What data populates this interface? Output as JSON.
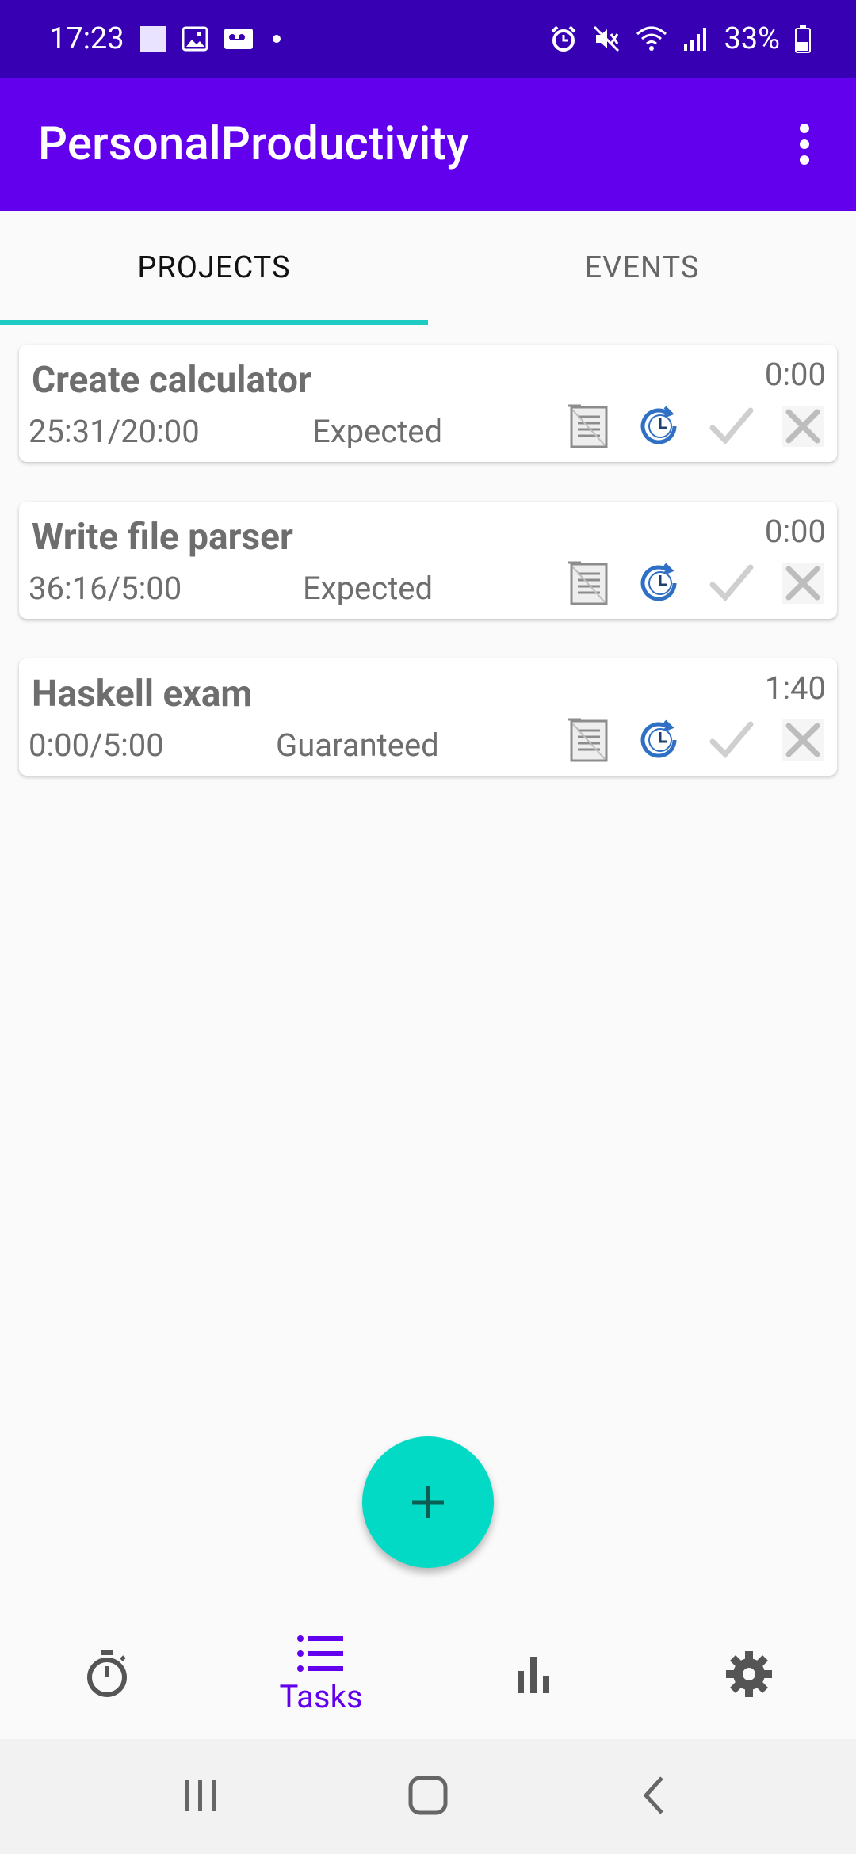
{
  "status_bar": {
    "time": "17:23",
    "battery": "33%",
    "icons_left": [
      "square-notification-icon",
      "gallery-icon",
      "voicemail-icon",
      "dot-icon"
    ],
    "icons_right": [
      "alarm-icon",
      "mute-icon",
      "wifi-icon",
      "signal-icon",
      "battery-icon"
    ]
  },
  "app_bar": {
    "title": "PersonalProductivity",
    "overflow_icon": "more-vert-icon"
  },
  "tabs": [
    {
      "label": "PROJECTS",
      "active": true
    },
    {
      "label": "EVENTS",
      "active": false
    }
  ],
  "projects": [
    {
      "title": "Create calculator",
      "time": "0:00",
      "progress": "25:31/20:00",
      "type": "Expected"
    },
    {
      "title": "Write file parser",
      "time": "0:00",
      "progress": "36:16/5:00",
      "type": "Expected"
    },
    {
      "title": "Haskell exam",
      "time": "1:40",
      "progress": "0:00/5:00",
      "type": "Guaranteed"
    }
  ],
  "card_actions": [
    "notes-icon",
    "clock-restart-icon",
    "check-icon",
    "close-icon"
  ],
  "fab": {
    "icon": "plus-icon"
  },
  "bottom_nav": [
    {
      "icon": "stopwatch-icon",
      "label": ""
    },
    {
      "icon": "list-icon",
      "label": "Tasks",
      "active": true
    },
    {
      "icon": "bar-chart-icon",
      "label": ""
    },
    {
      "icon": "gear-icon",
      "label": ""
    }
  ],
  "colors": {
    "status_bar": "#3700b3",
    "app_bar": "#6200ee",
    "accent": "#03dac5",
    "tab_indicator": "#1ccbc2",
    "primary_text": "#6200ee"
  }
}
